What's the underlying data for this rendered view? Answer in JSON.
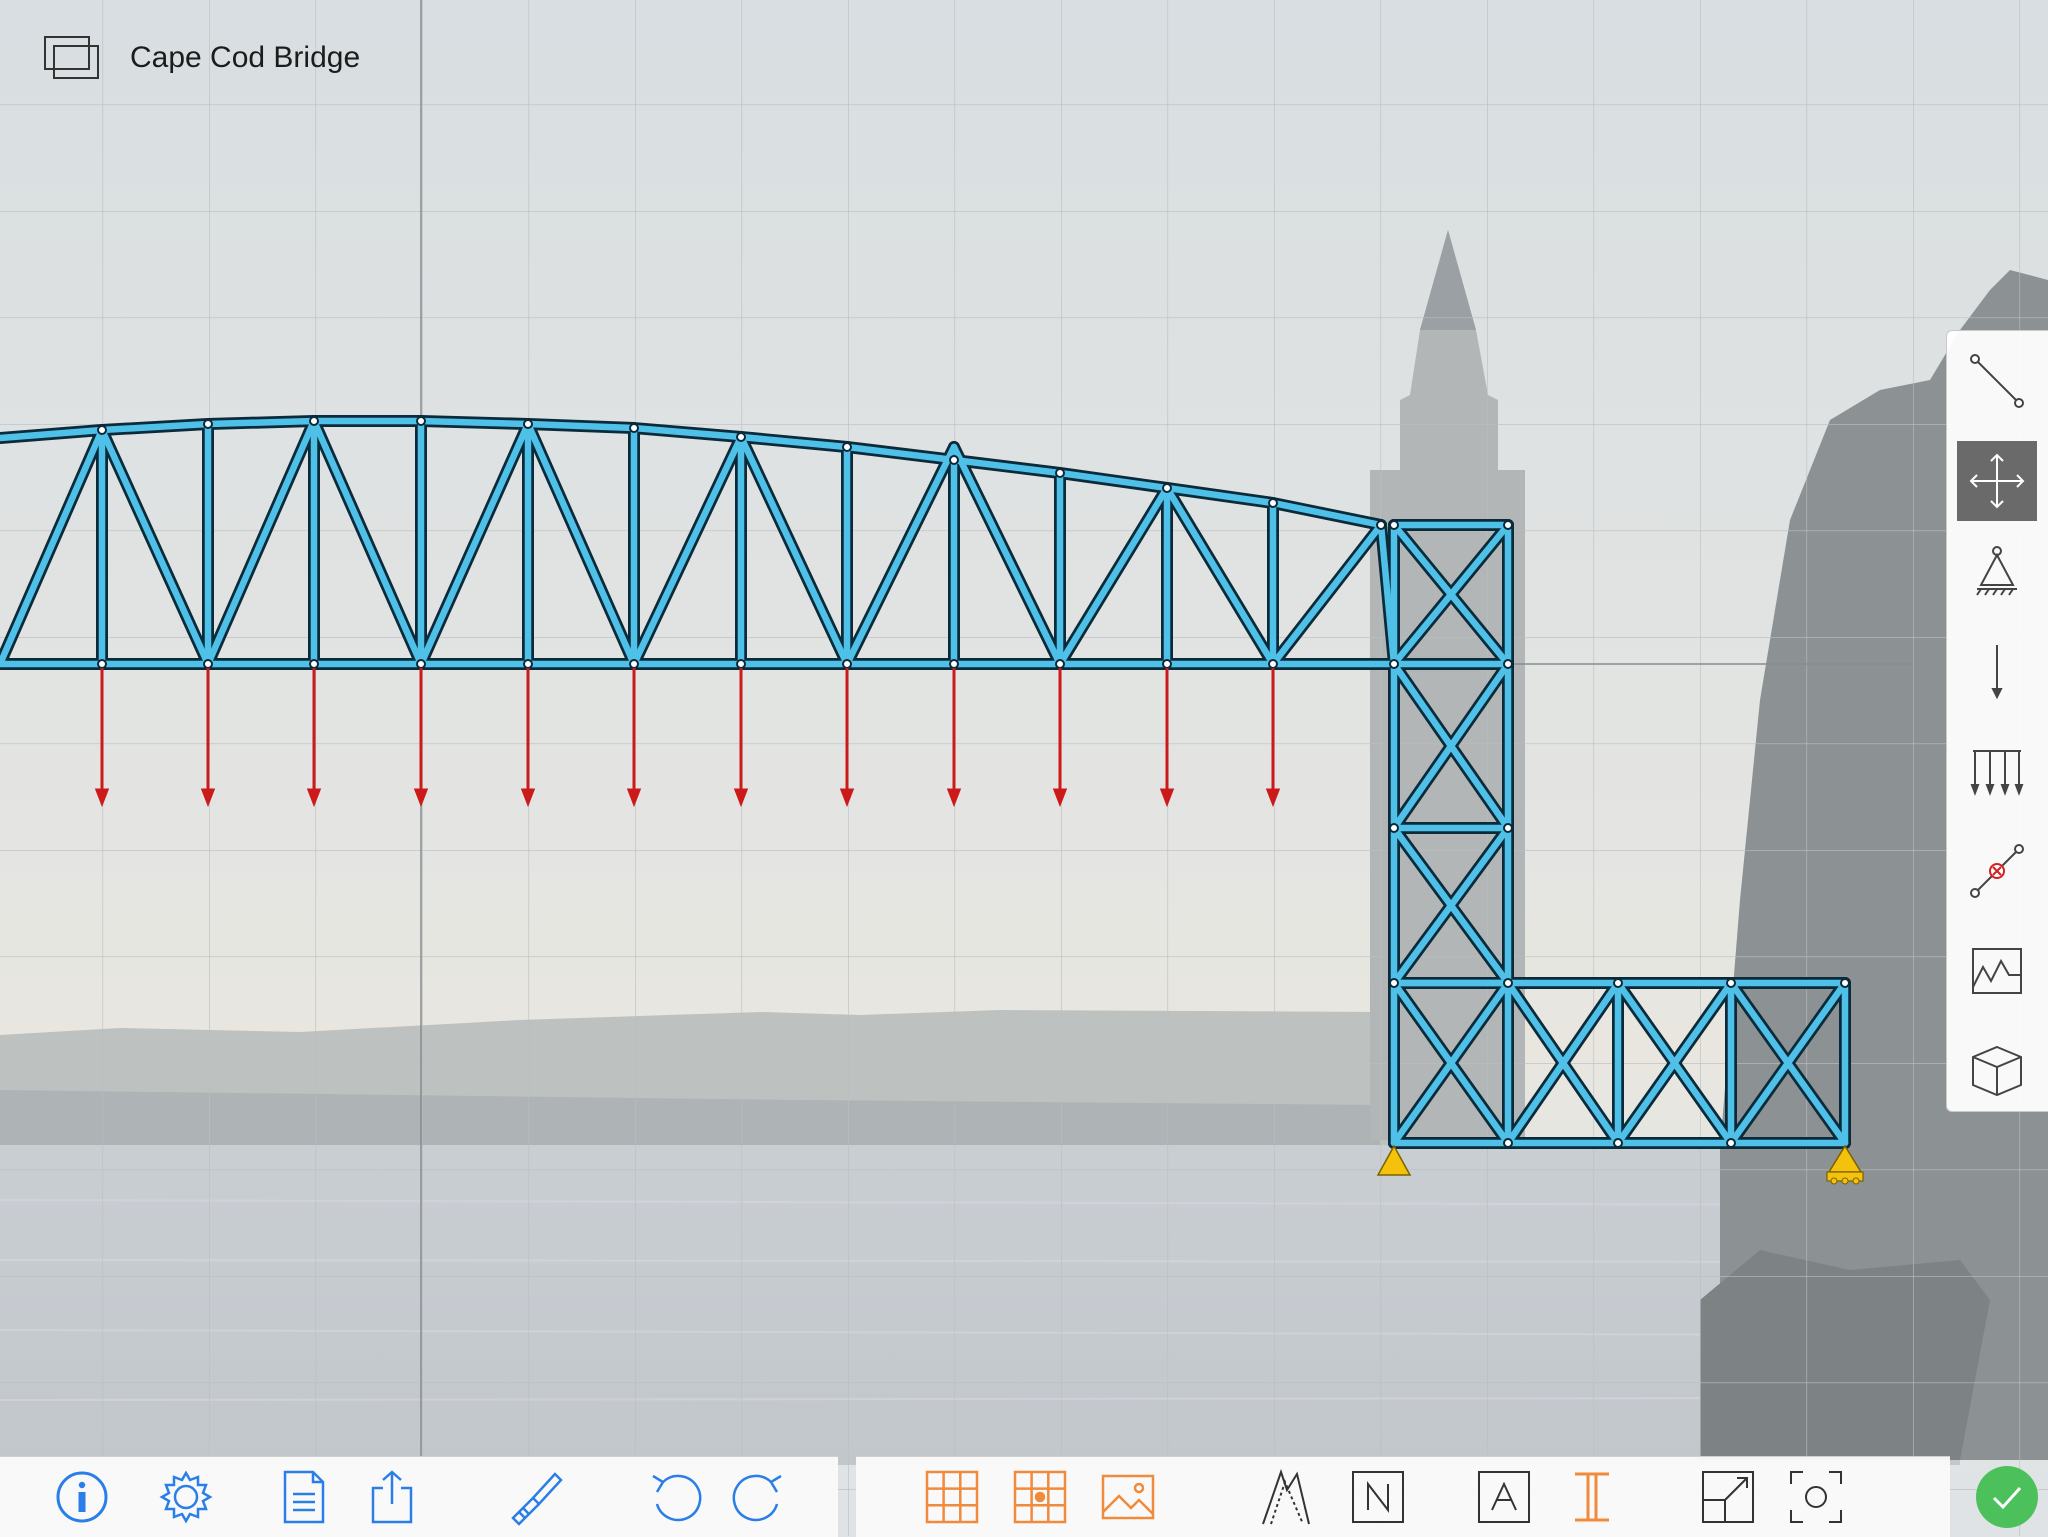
{
  "document": {
    "title": "Cape Cod Bridge"
  },
  "colors": {
    "member_fill": "#4fc0e8",
    "member_outline": "#0b2a3a",
    "load": "#cc1a1a",
    "support": "#f4c20d",
    "icon_blue": "#2a7ee8",
    "icon_orange": "#f08a3c",
    "done_green": "#4cc05b",
    "active_tool_bg": "#6a6a6a"
  },
  "sidebar": {
    "tools": [
      {
        "name": "member-tool",
        "icon": "line-icon"
      },
      {
        "name": "move-tool",
        "icon": "move-arrows-icon",
        "active": true
      },
      {
        "name": "support-tool",
        "icon": "pin-support-icon"
      },
      {
        "name": "point-load-tool",
        "icon": "arrow-down-icon"
      },
      {
        "name": "distributed-load-tool",
        "icon": "distributed-load-icon"
      },
      {
        "name": "release-tool",
        "icon": "hinge-release-icon"
      },
      {
        "name": "results-tool",
        "icon": "graph-icon"
      },
      {
        "name": "3d-view-tool",
        "icon": "cube-icon"
      }
    ]
  },
  "toolbar_left": [
    "info-icon",
    "settings-gear-icon",
    "document-icon",
    "share-icon",
    "brush-icon",
    "undo-icon",
    "redo-icon"
  ],
  "toolbar_right": [
    "grid-icon",
    "snap-grid-icon",
    "background-image-icon",
    "deformed-shape-icon",
    "node-labels-icon",
    "axial-force-labels-icon",
    "section-icon",
    "resize-icon",
    "zoom-fit-icon"
  ]
}
